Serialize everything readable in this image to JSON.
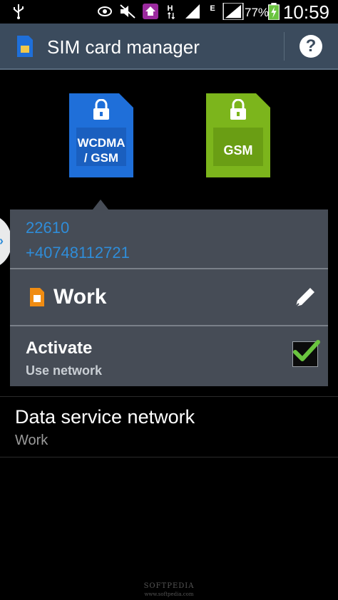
{
  "status_bar": {
    "battery_percent": "77%",
    "time": "10:59",
    "network_letters": [
      "H",
      "E"
    ]
  },
  "app_bar": {
    "title": "SIM card manager",
    "help_symbol": "?"
  },
  "sim_cards": [
    {
      "label_line1": "WCDMA",
      "label_line2": "/ GSM",
      "color": "#1f6fd9"
    },
    {
      "label_line1": "GSM",
      "label_line2": "",
      "color": "#7cb51c"
    }
  ],
  "sim_details": {
    "network_code": "22610",
    "phone_number": "+40748112721",
    "sim_name": "Work",
    "activate_title": "Activate",
    "activate_subtitle": "Use network",
    "activate_checked": true
  },
  "data_service": {
    "title": "Data service network",
    "value": "Work"
  },
  "watermark": {
    "brand": "SOFTPEDIA",
    "url": "www.softpedia.com"
  },
  "colors": {
    "accent_blue": "#2f8dd9",
    "app_bar": "#3b4b5d",
    "popup": "#464c56",
    "check_green": "#6ac43f"
  }
}
